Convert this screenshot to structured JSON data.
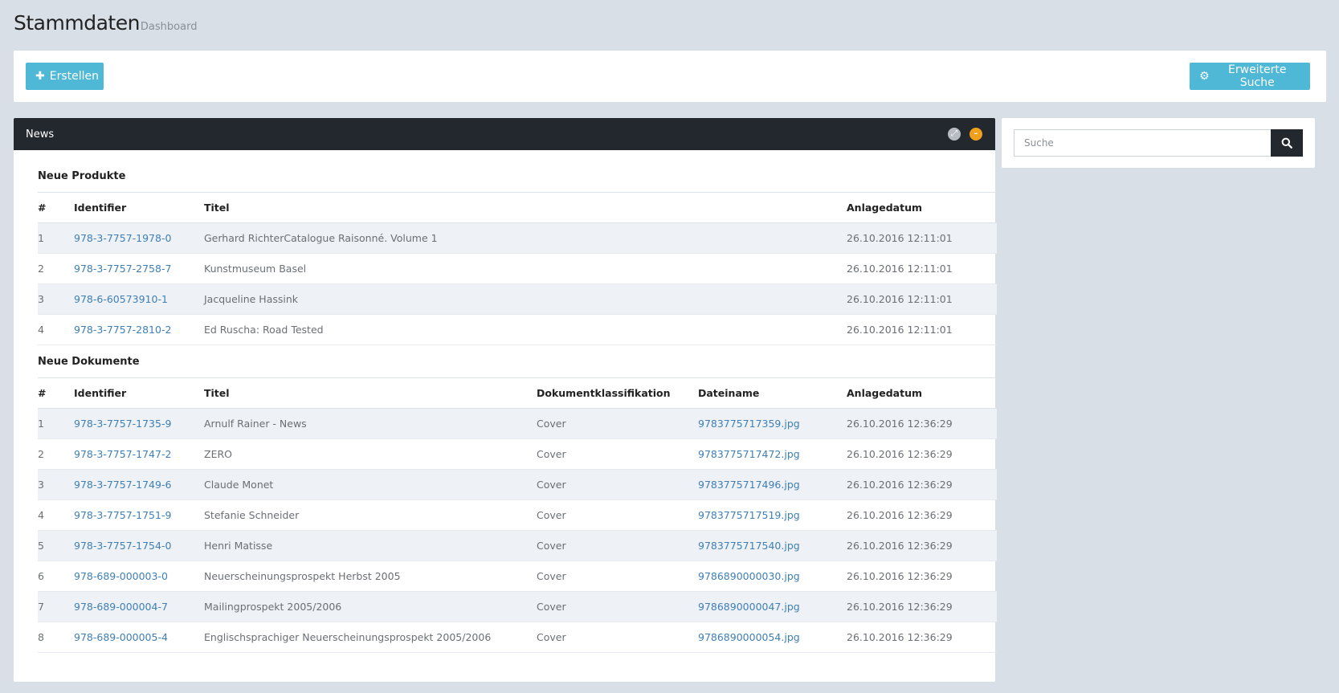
{
  "header": {
    "title": "Stammdaten",
    "subtitle": "Dashboard"
  },
  "toolbar": {
    "create_label": "Erstellen",
    "advanced_search_label": "Erweiterte Suche"
  },
  "panel": {
    "title": "News"
  },
  "products": {
    "title": "Neue Produkte",
    "columns": [
      "#",
      "Identifier",
      "Titel",
      "Anlagedatum"
    ],
    "rows": [
      {
        "n": "1",
        "id": "978-3-7757-1978-0",
        "title": "Gerhard RichterCatalogue Raisonné. Volume 1",
        "date": "26.10.2016 12:11:01"
      },
      {
        "n": "2",
        "id": "978-3-7757-2758-7",
        "title": "Kunstmuseum Basel",
        "date": "26.10.2016 12:11:01"
      },
      {
        "n": "3",
        "id": "978-6-60573910-1",
        "title": "Jacqueline Hassink",
        "date": "26.10.2016 12:11:01"
      },
      {
        "n": "4",
        "id": "978-3-7757-2810-2",
        "title": "Ed Ruscha: Road Tested",
        "date": "26.10.2016 12:11:01"
      }
    ]
  },
  "documents": {
    "title": "Neue Dokumente",
    "columns": [
      "#",
      "Identifier",
      "Titel",
      "Dokumentklassifikation",
      "Dateiname",
      "Anlagedatum"
    ],
    "rows": [
      {
        "n": "1",
        "id": "978-3-7757-1735-9",
        "title": "Arnulf Rainer - News",
        "class": "Cover",
        "file": "9783775717359.jpg",
        "date": "26.10.2016 12:36:29"
      },
      {
        "n": "2",
        "id": "978-3-7757-1747-2",
        "title": "ZERO",
        "class": "Cover",
        "file": "9783775717472.jpg",
        "date": "26.10.2016 12:36:29"
      },
      {
        "n": "3",
        "id": "978-3-7757-1749-6",
        "title": "Claude Monet",
        "class": "Cover",
        "file": "9783775717496.jpg",
        "date": "26.10.2016 12:36:29"
      },
      {
        "n": "4",
        "id": "978-3-7757-1751-9",
        "title": "Stefanie Schneider",
        "class": "Cover",
        "file": "9783775717519.jpg",
        "date": "26.10.2016 12:36:29"
      },
      {
        "n": "5",
        "id": "978-3-7757-1754-0",
        "title": "Henri Matisse",
        "class": "Cover",
        "file": "9783775717540.jpg",
        "date": "26.10.2016 12:36:29"
      },
      {
        "n": "6",
        "id": "978-689-000003-0",
        "title": "Neuerscheinungsprospekt Herbst 2005",
        "class": "Cover",
        "file": "9786890000030.jpg",
        "date": "26.10.2016 12:36:29"
      },
      {
        "n": "7",
        "id": "978-689-000004-7",
        "title": "Mailingprospekt 2005/2006",
        "class": "Cover",
        "file": "9786890000047.jpg",
        "date": "26.10.2016 12:36:29"
      },
      {
        "n": "8",
        "id": "978-689-000005-4",
        "title": "Englischsprachiger Neuerscheinungsprospekt 2005/2006",
        "class": "Cover",
        "file": "9786890000054.jpg",
        "date": "26.10.2016 12:36:29"
      }
    ]
  },
  "search": {
    "placeholder": "Suche"
  },
  "icons": {
    "create": "plus-icon",
    "advanced_search": "gear-icon",
    "expand": "expand-icon",
    "collapse": "minus-icon",
    "search": "search-icon"
  },
  "colors": {
    "accent": "#4fb8d6",
    "dark": "#23272e",
    "link": "#3f7fb5",
    "warning": "#f0a01c"
  }
}
